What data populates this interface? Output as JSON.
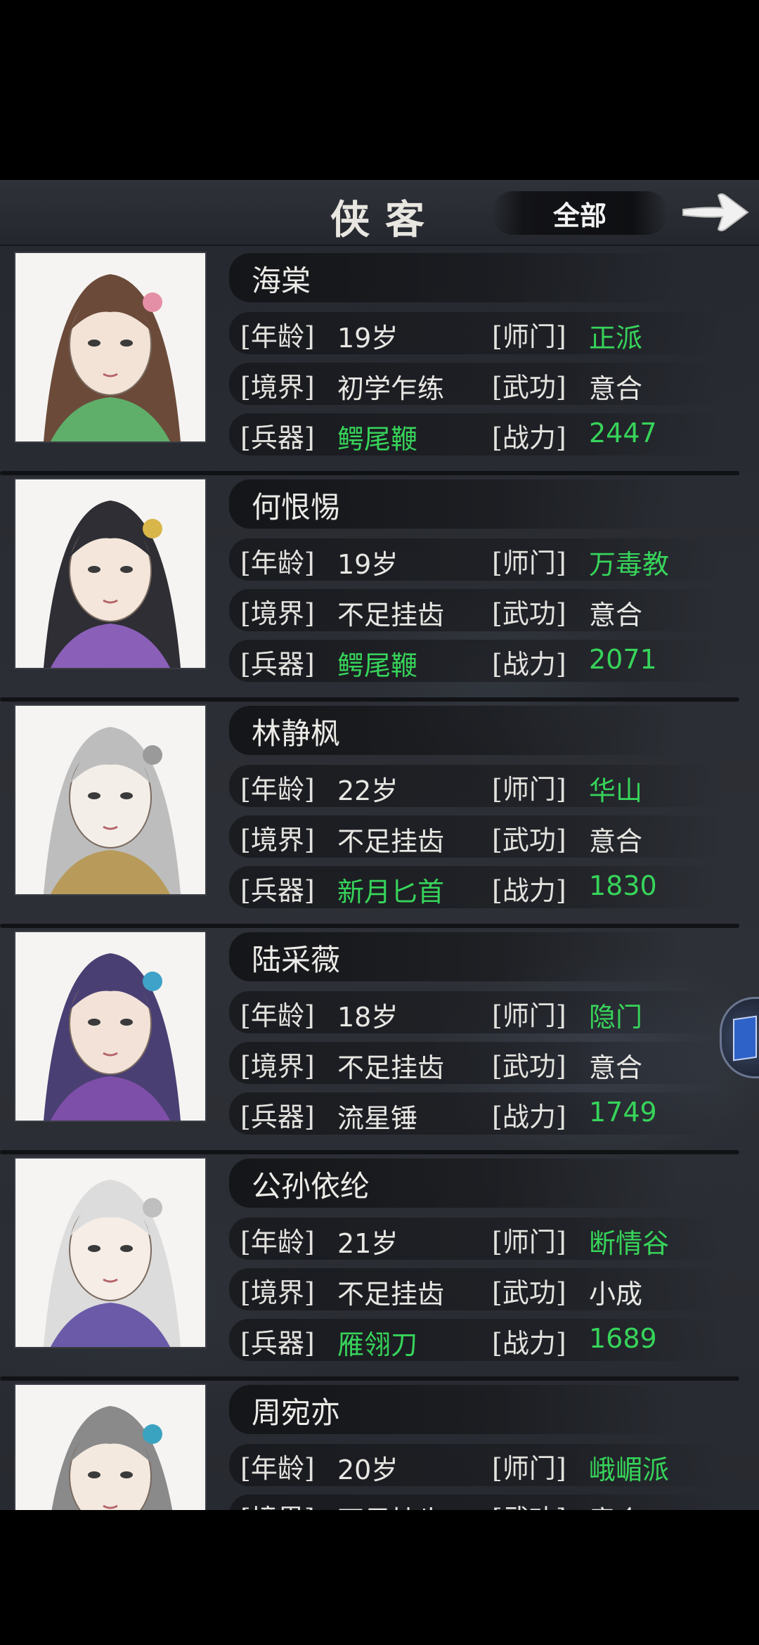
{
  "header": {
    "title": "侠客",
    "filter_label": "全部",
    "next_icon": "arrow-right-icon"
  },
  "field_labels": {
    "age": "[年龄]",
    "sect": "[师门]",
    "realm": "[境界]",
    "martial": "[武功]",
    "weapon": "[兵器]",
    "power": "[战力]"
  },
  "colors": {
    "highlight": "#37d45a",
    "text": "#e8e7e3",
    "background": "#2a2d33"
  },
  "characters": [
    {
      "name": "海棠",
      "age": "19岁",
      "sect": "正派",
      "realm": "初学乍练",
      "martial": "意合",
      "weapon": "鳄尾鞭",
      "power": "2447",
      "sect_highlight": true,
      "weapon_highlight": true
    },
    {
      "name": "何恨惕",
      "age": "19岁",
      "sect": "万毒教",
      "realm": "不足挂齿",
      "martial": "意合",
      "weapon": "鳄尾鞭",
      "power": "2071",
      "sect_highlight": true,
      "weapon_highlight": true
    },
    {
      "name": "林静枫",
      "age": "22岁",
      "sect": "华山",
      "realm": "不足挂齿",
      "martial": "意合",
      "weapon": "新月匕首",
      "power": "1830",
      "sect_highlight": true,
      "weapon_highlight": true
    },
    {
      "name": "陆采薇",
      "age": "18岁",
      "sect": "隐门",
      "realm": "不足挂齿",
      "martial": "意合",
      "weapon": "流星锤",
      "power": "1749",
      "sect_highlight": true,
      "weapon_highlight": false
    },
    {
      "name": "公孙依纶",
      "age": "21岁",
      "sect": "断情谷",
      "realm": "不足挂齿",
      "martial": "小成",
      "weapon": "雁翎刀",
      "power": "1689",
      "sect_highlight": true,
      "weapon_highlight": true
    },
    {
      "name": "周宛亦",
      "age": "20岁",
      "sect": "峨嵋派",
      "realm": "不足挂齿",
      "martial": "意合",
      "weapon": "",
      "power": "",
      "sect_highlight": true,
      "weapon_highlight": false
    }
  ]
}
